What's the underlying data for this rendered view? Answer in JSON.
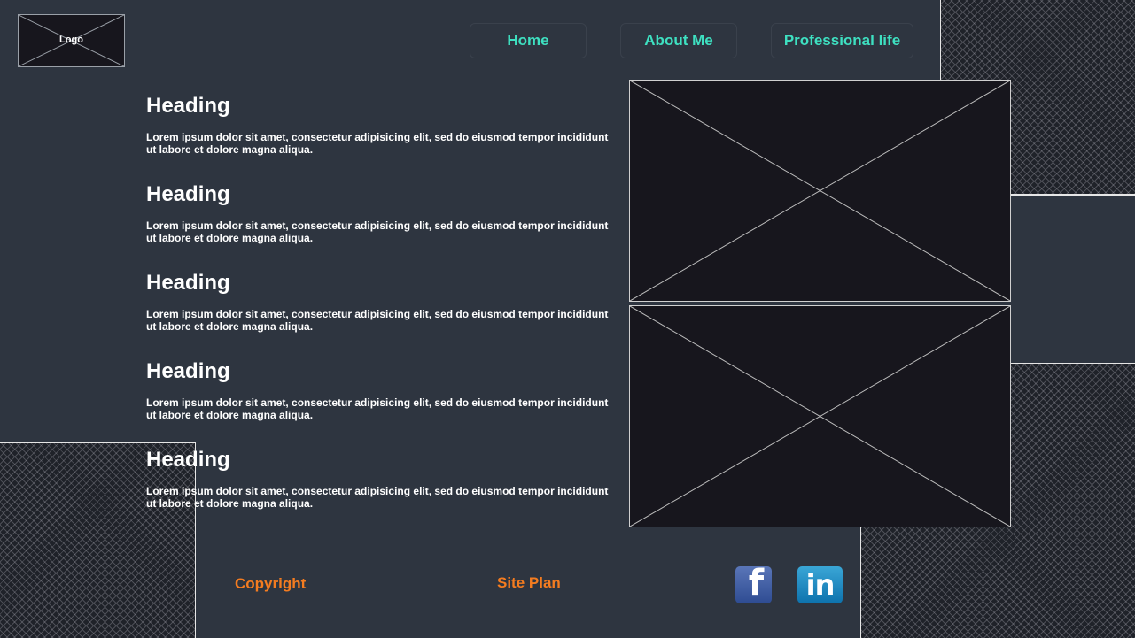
{
  "header": {
    "logo_label": "Logo",
    "nav": [
      {
        "label": "Home"
      },
      {
        "label": "About Me"
      },
      {
        "label": "Professional life"
      }
    ]
  },
  "sections": [
    {
      "heading": "Heading",
      "text": "Lorem ipsum dolor sit amet, consectetur adipisicing elit, sed do eiusmod tempor incididunt ut labore et dolore magna aliqua."
    },
    {
      "heading": "Heading",
      "text": "Lorem ipsum dolor sit amet, consectetur adipisicing elit, sed do eiusmod tempor incididunt ut labore et dolore magna aliqua."
    },
    {
      "heading": "Heading",
      "text": "Lorem ipsum dolor sit amet, consectetur adipisicing elit, sed do eiusmod tempor incididunt ut labore et dolore magna aliqua."
    },
    {
      "heading": "Heading",
      "text": "Lorem ipsum dolor sit amet, consectetur adipisicing elit, sed do eiusmod tempor incididunt ut labore et dolore magna aliqua."
    },
    {
      "heading": "Heading",
      "text": "Lorem ipsum dolor sit amet, consectetur adipisicing elit, sed do eiusmod tempor incididunt ut labore et dolore magna aliqua."
    }
  ],
  "footer": {
    "copyright": "Copyright",
    "site_plan": "Site Plan",
    "social": [
      {
        "icon": "facebook-icon",
        "glyph": "f"
      },
      {
        "icon": "linkedin-icon",
        "glyph": "in"
      }
    ]
  },
  "colors": {
    "background": "#2e3540",
    "nav_text": "#3ee0c1",
    "footer_text": "#f47c20",
    "placeholder_fill": "#17161d"
  }
}
